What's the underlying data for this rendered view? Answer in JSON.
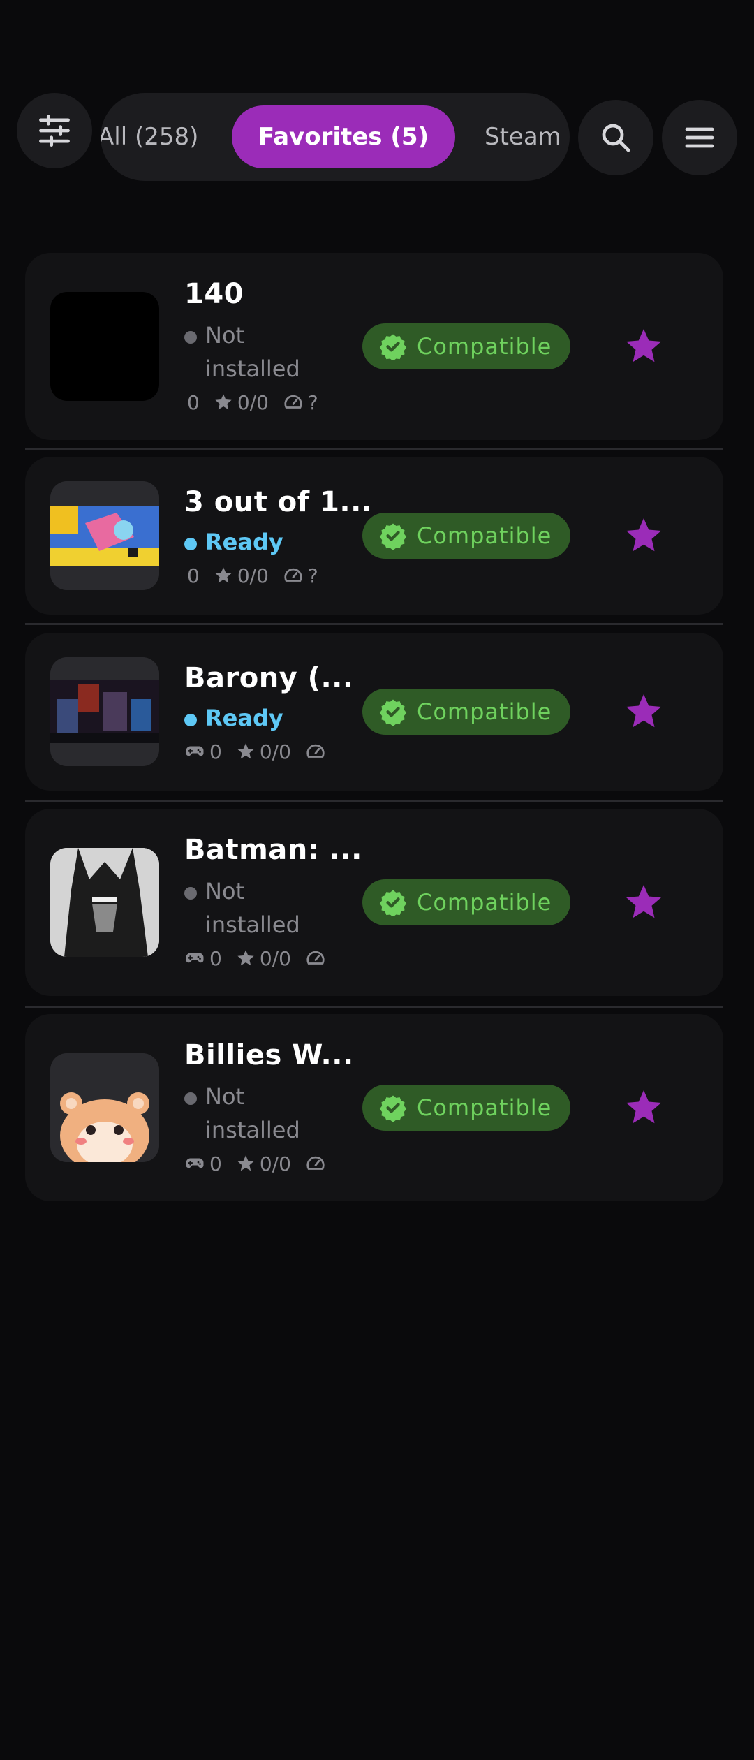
{
  "header": {
    "filter_icon": "sliders-icon",
    "tabs": [
      {
        "label": "All (258)",
        "active": false
      },
      {
        "label": "Favorites (5)",
        "active": true
      },
      {
        "label": "Steam",
        "active": false
      }
    ],
    "search_icon": "search-icon",
    "menu_icon": "hamburger-menu-icon"
  },
  "colors": {
    "background": "#0a0a0c",
    "card": "#131315",
    "accent": "#9b2cb8",
    "ready": "#5ec8f5",
    "compatible_bg": "#2f5b26",
    "compatible_text": "#6fd25e"
  },
  "games": [
    {
      "title": "140",
      "status": "Not installed",
      "ready": false,
      "meta": {
        "controller": false,
        "count": "0",
        "rating": "0/0",
        "perf": "?"
      },
      "badge": "Compatible",
      "favorite": true
    },
    {
      "title": "3 out of 1...",
      "status": "Ready",
      "ready": true,
      "meta": {
        "controller": false,
        "count": "0",
        "rating": "0/0",
        "perf": "?"
      },
      "badge": "Compatible",
      "favorite": true
    },
    {
      "title": "Barony (...",
      "status": "Ready",
      "ready": true,
      "meta": {
        "controller": true,
        "count": "0",
        "rating": "0/0",
        "perf": ""
      },
      "badge": "Compatible",
      "favorite": true
    },
    {
      "title": "Batman: ...",
      "status": "Not installed",
      "ready": false,
      "meta": {
        "controller": true,
        "count": "0",
        "rating": "0/0",
        "perf": ""
      },
      "badge": "Compatible",
      "favorite": true
    },
    {
      "title": "Billies W...",
      "status": "Not installed",
      "ready": false,
      "meta": {
        "controller": true,
        "count": "0",
        "rating": "0/0",
        "perf": ""
      },
      "badge": "Compatible",
      "favorite": true
    }
  ]
}
